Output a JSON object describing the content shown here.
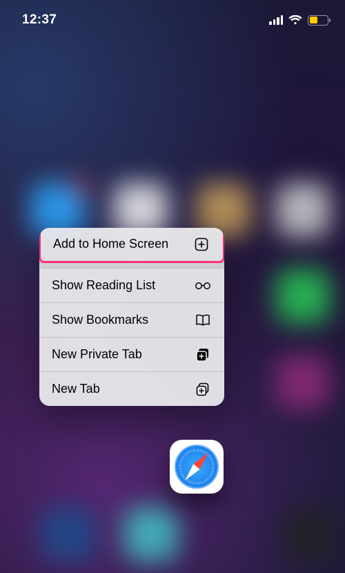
{
  "status": {
    "time": "12:37"
  },
  "menu": {
    "items": [
      {
        "label": "Add to Home Screen",
        "icon": "plus-square-icon",
        "highlighted": true
      },
      {
        "label": "Show Reading List",
        "icon": "glasses-icon"
      },
      {
        "label": "Show Bookmarks",
        "icon": "book-icon"
      },
      {
        "label": "New Private Tab",
        "icon": "tabs-private-icon"
      },
      {
        "label": "New Tab",
        "icon": "tabs-icon"
      }
    ]
  },
  "app": {
    "name": "Safari"
  },
  "colors": {
    "highlight": "#ff2d78",
    "battery_fill": "#ffcc00"
  }
}
